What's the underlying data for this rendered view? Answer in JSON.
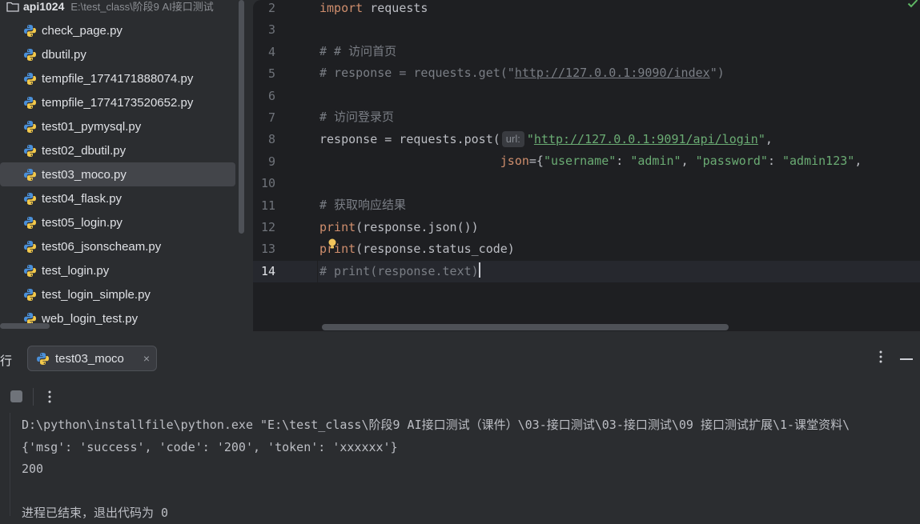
{
  "project": {
    "name": "api1024",
    "path": "E:\\test_class\\阶段9 AI接口测试",
    "files": [
      {
        "name": "check_page.py",
        "selected": false
      },
      {
        "name": "dbutil.py",
        "selected": false
      },
      {
        "name": "tempfile_1774171888074.py",
        "selected": false
      },
      {
        "name": "tempfile_1774173520652.py",
        "selected": false
      },
      {
        "name": "test01_pymysql.py",
        "selected": false
      },
      {
        "name": "test02_dbutil.py",
        "selected": false
      },
      {
        "name": "test03_moco.py",
        "selected": true
      },
      {
        "name": "test04_flask.py",
        "selected": false
      },
      {
        "name": "test05_login.py",
        "selected": false
      },
      {
        "name": "test06_jsonscheam.py",
        "selected": false
      },
      {
        "name": "test_login.py",
        "selected": false
      },
      {
        "name": "test_login_simple.py",
        "selected": false
      },
      {
        "name": "web_login_test.py",
        "selected": false
      }
    ]
  },
  "editor": {
    "line_numbers": [
      "2",
      "3",
      "4",
      "5",
      "6",
      "7",
      "8",
      "9",
      "10",
      "11",
      "12",
      "13",
      "14"
    ],
    "current_line": "14",
    "code": {
      "l2_kw": "import",
      "l2_rest": " requests",
      "l4": "# # 访问首页",
      "l5_a": "# response = requests.get(\"",
      "l5_url": "http://127.0.0.1:9090/index",
      "l5_b": "\")",
      "l7": "# 访问登录页",
      "l8_a": "response = requests.post(",
      "l8_hint": "url:",
      "l8_q1": "\"",
      "l8_url": "http://127.0.0.1:9091/api/login",
      "l8_q2": "\"",
      "l8_b": ",",
      "l9_indent": "                         ",
      "l9_param": "json",
      "l9_eq": "={",
      "l9_k1": "\"username\"",
      "l9_c1": ": ",
      "l9_v1": "\"admin\"",
      "l9_sep": ", ",
      "l9_k2": "\"password\"",
      "l9_c2": ": ",
      "l9_v2": "\"admin123\"",
      "l9_end": ",",
      "l11": "# 获取响应结果",
      "l12_fn": "print",
      "l12_rest": "(response.json())",
      "l13_fn": "print",
      "l13_rest": "(response.status_code)",
      "l14": "# print(response.text)"
    }
  },
  "run_panel": {
    "title": "行",
    "tab_label": "test03_moco",
    "tab_close": "×",
    "console": [
      "D:\\python\\installfile\\python.exe \"E:\\test_class\\阶段9 AI接口测试（课件）\\03-接口测试\\03-接口测试\\09 接口测试扩展\\1-课堂资料\\",
      "{'msg': 'success', 'code': '200', 'token': 'xxxxxx'}",
      "200",
      "",
      "进程已结束，退出代码为 0"
    ]
  },
  "colors": {
    "keyword": "#cf8e6d",
    "comment": "#7a7e85",
    "string": "#6aab73",
    "editor_bg": "#1e1f22",
    "panel_bg": "#2b2d30"
  }
}
